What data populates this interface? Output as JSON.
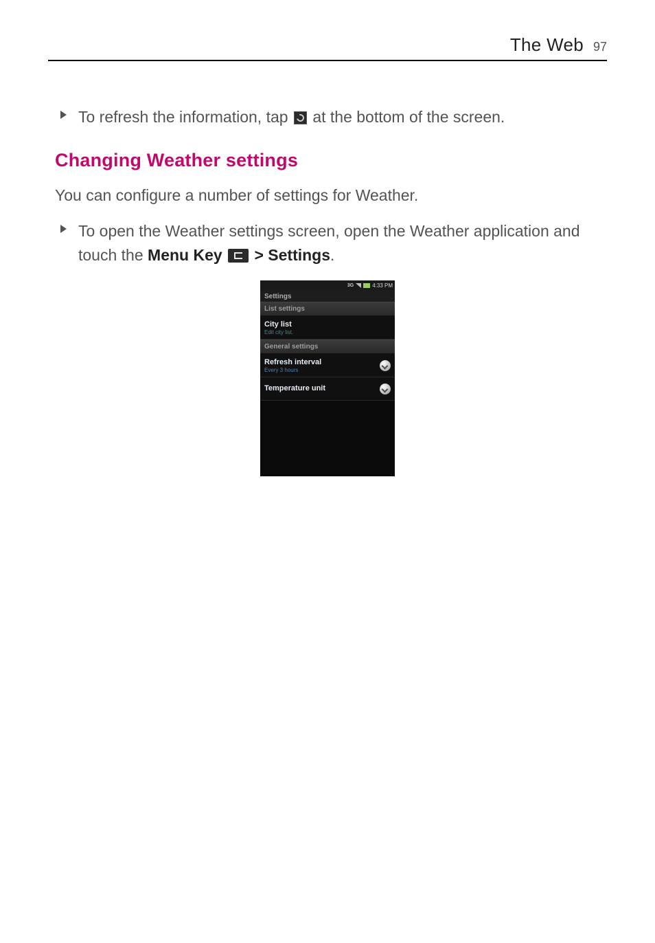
{
  "header": {
    "title": "The Web",
    "page_number": "97"
  },
  "refresh_line": {
    "prefix": "To refresh the information, tap ",
    "suffix": " at the bottom of the screen."
  },
  "section_heading": "Changing Weather settings",
  "intro_para": "You can configure a number of settings for Weather.",
  "open_settings": {
    "prefix": "To open the Weather settings screen, open the Weather application and touch the ",
    "menu_key_label": "Menu Key",
    "separator": " > ",
    "settings_label": "Settings",
    "suffix": "."
  },
  "screenshot": {
    "statusbar_time": "4:33 PM",
    "title": "Settings",
    "section_list": "List settings",
    "city_list": {
      "title": "City list",
      "sub": "Edit city list."
    },
    "section_general": "General settings",
    "refresh_interval": {
      "title": "Refresh interval",
      "sub": "Every 3 hours"
    },
    "temp_unit": {
      "title": "Temperature unit",
      "sub": ""
    }
  },
  "chart_data": {
    "type": "table",
    "title": "Weather Settings screen",
    "sections": [
      {
        "header": "List settings",
        "rows": [
          {
            "title": "City list",
            "subtitle": "Edit city list."
          }
        ]
      },
      {
        "header": "General settings",
        "rows": [
          {
            "title": "Refresh interval",
            "subtitle": "Every 3 hours",
            "control": "dropdown"
          },
          {
            "title": "Temperature unit",
            "subtitle": "",
            "control": "dropdown"
          }
        ]
      }
    ],
    "statusbar_time": "4:33 PM"
  }
}
